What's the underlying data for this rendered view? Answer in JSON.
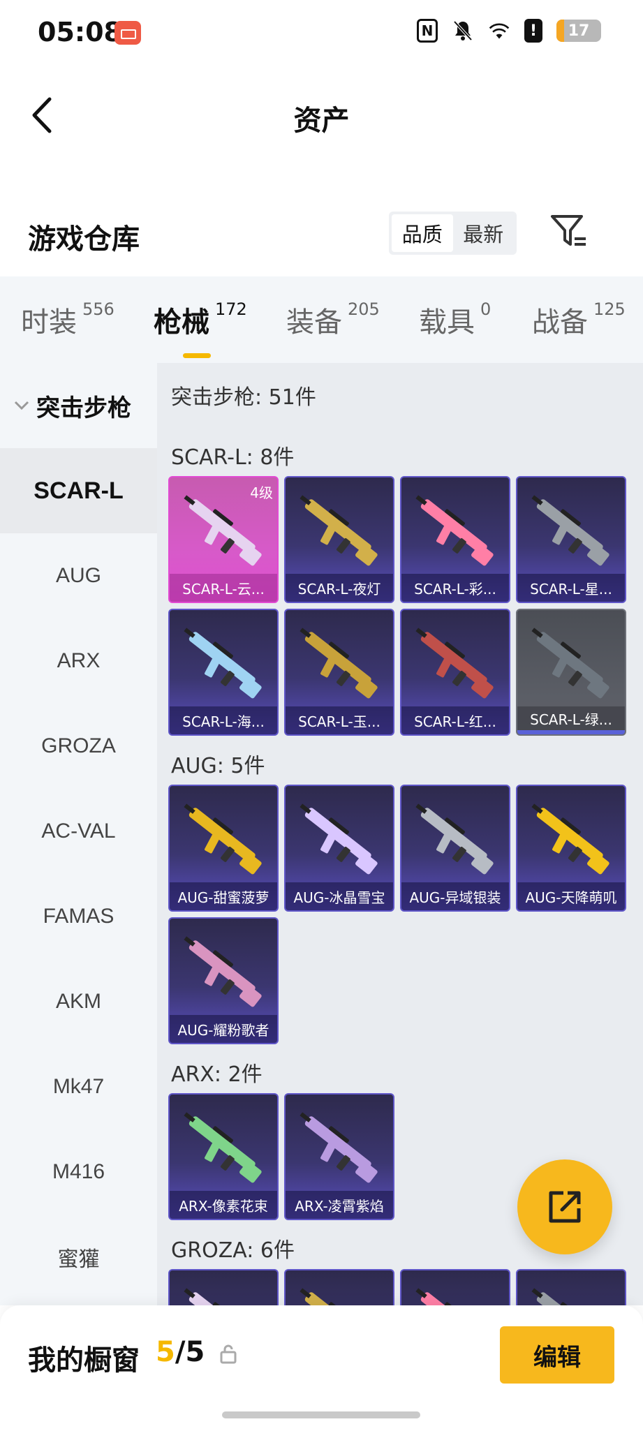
{
  "status_bar": {
    "time": "05:08",
    "battery": "17",
    "battery_level": 0.17
  },
  "header": {
    "title": "资产"
  },
  "warehouse": {
    "title": "游戏仓库",
    "sort_options": [
      "品质",
      "最新"
    ],
    "sort_selected": "品质"
  },
  "tabs": [
    {
      "label": "时装",
      "count": "556"
    },
    {
      "label": "枪械",
      "count": "172"
    },
    {
      "label": "装备",
      "count": "205"
    },
    {
      "label": "载具",
      "count": "0"
    },
    {
      "label": "战备",
      "count": "125"
    }
  ],
  "sidebar": {
    "group": "突击步枪",
    "items": [
      "SCAR-L",
      "AUG",
      "ARX",
      "GROZA",
      "AC-VAL",
      "FAMAS",
      "AKM",
      "Mk47",
      "M416",
      "蜜獾"
    ],
    "selected": "SCAR-L"
  },
  "content": {
    "summary": "突击步枪: 51件",
    "sections": [
      {
        "title": "SCAR-L: 8件",
        "items": [
          {
            "name": "SCAR-L-云...",
            "level": "4级",
            "rarity": "gold"
          },
          {
            "name": "SCAR-L-夜灯",
            "rarity": "purple"
          },
          {
            "name": "SCAR-L-彩...",
            "rarity": "purple"
          },
          {
            "name": "SCAR-L-星...",
            "rarity": "purple"
          },
          {
            "name": "SCAR-L-海...",
            "rarity": "purple"
          },
          {
            "name": "SCAR-L-玉...",
            "rarity": "purple"
          },
          {
            "name": "SCAR-L-红...",
            "rarity": "purple"
          },
          {
            "name": "SCAR-L-绿...",
            "rarity": "grey"
          }
        ]
      },
      {
        "title": "AUG: 5件",
        "items": [
          {
            "name": "AUG-甜蜜菠萝",
            "rarity": "purple"
          },
          {
            "name": "AUG-冰晶雪宝",
            "rarity": "purple"
          },
          {
            "name": "AUG-异域银装",
            "rarity": "purple"
          },
          {
            "name": "AUG-天降萌叽",
            "rarity": "purple"
          },
          {
            "name": "AUG-耀粉歌者",
            "rarity": "purple"
          }
        ]
      },
      {
        "title": "ARX: 2件",
        "items": [
          {
            "name": "ARX-像素花束",
            "rarity": "purple"
          },
          {
            "name": "ARX-凌霄紫焰",
            "rarity": "purple"
          }
        ]
      },
      {
        "title": "GROZA: 6件",
        "items": []
      }
    ]
  },
  "bottom_bar": {
    "showcase_label": "我的橱窗",
    "showcase_used": "5",
    "showcase_total": "/5",
    "edit_label": "编辑"
  },
  "colors": {
    "accent": "#f7b81d",
    "purple_card": "#3b3670",
    "gold_card": "#d75ac9",
    "grey_card": "#5b5e66"
  }
}
